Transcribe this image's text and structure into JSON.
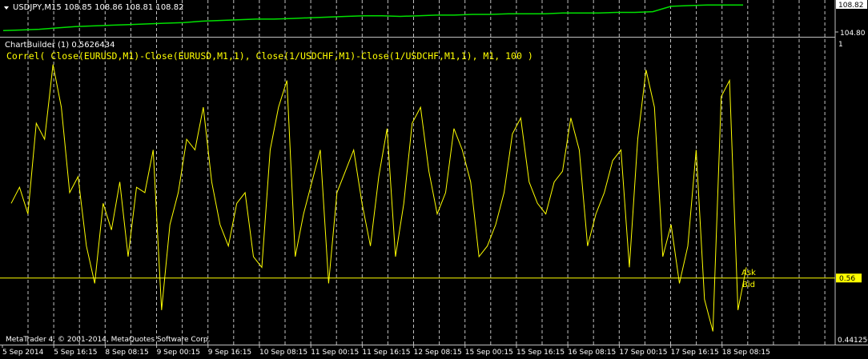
{
  "top_panel": {
    "header": "USDJPY,M15  108.85 108.86 108.81 108.82",
    "price_high": "108.82",
    "price_low": "104.80"
  },
  "indicator_panel": {
    "header": "ChartBuilder (1) 0.5626434",
    "formula": "Correl( Close(EURUSD,M1)-Close(EURUSD,M1,1), Close(1/USDCHF,M1)-Close(1/USDCHF,M1,1), M1, 100 )",
    "axis_max": "1",
    "current_value": "0.56",
    "axis_min": "0.441250",
    "ask_label": "Ask",
    "bid_label": "Bid"
  },
  "copyright": "MetaTrader 4, © 2001-2014, MetaQuotes Software Corp.",
  "time_axis": [
    "5 Sep 2014",
    "5 Sep 16:15",
    "8 Sep 08:15",
    "9 Sep 00:15",
    "9 Sep 16:15",
    "10 Sep 08:15",
    "11 Sep 00:15",
    "11 Sep 16:15",
    "12 Sep 08:15",
    "15 Sep 00:15",
    "15 Sep 16:15",
    "16 Sep 08:15",
    "17 Sep 00:15",
    "17 Sep 16:15",
    "18 Sep 08:15"
  ],
  "colors": {
    "price_line": "#00e000",
    "indicator_line": "#ffff00",
    "grid": "#c0c0c0",
    "level_line": "#ffff00"
  },
  "chart_data": [
    {
      "type": "line",
      "series": [
        {
          "name": "USDJPY,M15",
          "values": [
            105.0,
            105.1,
            105.2,
            105.4,
            105.6,
            105.7,
            105.8,
            105.9,
            106.0,
            106.1,
            106.2,
            106.4,
            106.5,
            106.6,
            106.7,
            106.7,
            106.8,
            106.9,
            107.0,
            107.1,
            107.2,
            107.2,
            107.1,
            107.2,
            107.3,
            107.3,
            107.4,
            107.4,
            107.5,
            107.5,
            107.5,
            107.6,
            107.6,
            107.6,
            107.7,
            107.7,
            107.8,
            108.6,
            108.7,
            108.8,
            108.8,
            108.8
          ]
        }
      ],
      "ylim": [
        104.8,
        108.82
      ]
    },
    {
      "type": "line",
      "series": [
        {
          "name": "ChartBuilder (1)",
          "values": [
            0.7,
            0.73,
            0.68,
            0.85,
            0.82,
            0.96,
            0.88,
            0.72,
            0.75,
            0.62,
            0.55,
            0.7,
            0.65,
            0.74,
            0.6,
            0.73,
            0.72,
            0.8,
            0.5,
            0.66,
            0.72,
            0.82,
            0.8,
            0.88,
            0.74,
            0.66,
            0.62,
            0.7,
            0.72,
            0.6,
            0.58,
            0.8,
            0.88,
            0.93,
            0.6,
            0.68,
            0.74,
            0.8,
            0.55,
            0.72,
            0.76,
            0.8,
            0.7,
            0.62,
            0.75,
            0.84,
            0.6,
            0.7,
            0.85,
            0.88,
            0.76,
            0.68,
            0.72,
            0.84,
            0.8,
            0.74,
            0.6,
            0.62,
            0.66,
            0.72,
            0.83,
            0.86,
            0.74,
            0.7,
            0.68,
            0.74,
            0.76,
            0.86,
            0.8,
            0.62,
            0.68,
            0.72,
            0.78,
            0.8,
            0.58,
            0.82,
            0.95,
            0.88,
            0.6,
            0.66,
            0.55,
            0.62,
            0.8,
            0.52,
            0.46,
            0.9,
            0.93,
            0.5,
            0.58
          ]
        }
      ],
      "ylim": [
        0.44125,
        1
      ]
    }
  ]
}
